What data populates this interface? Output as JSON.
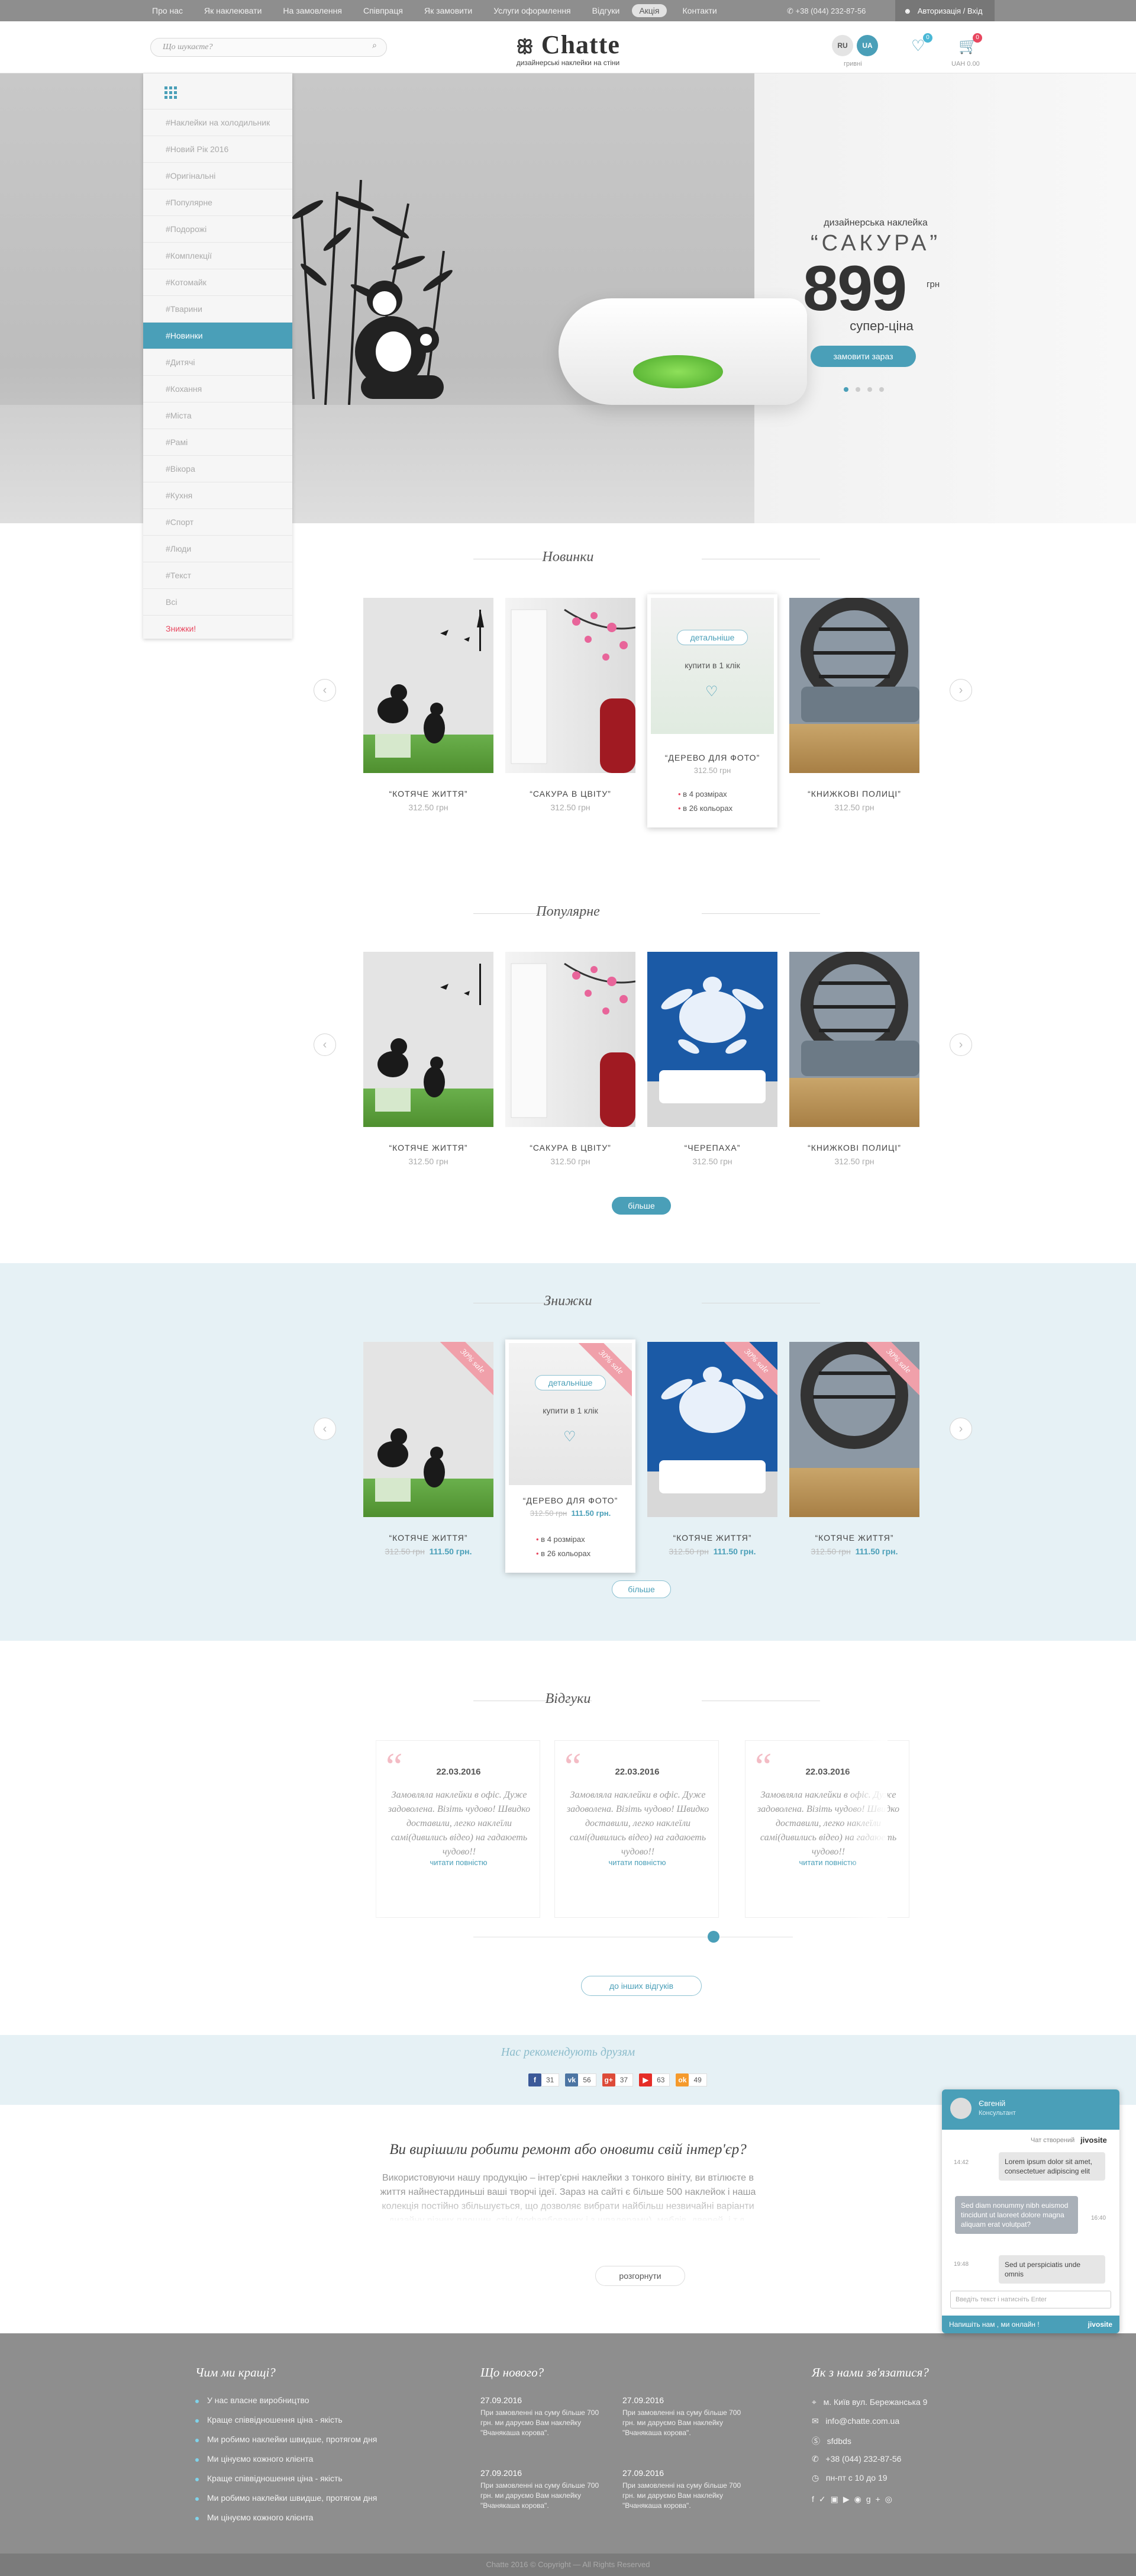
{
  "topnav": {
    "items": [
      "Про нас",
      "Як наклеювати",
      "На замовлення",
      "Співпраця",
      "Як замовити",
      "Услуги оформлення",
      "Відгуки",
      "Акція",
      "Контакти"
    ],
    "phone": "+38 (044) 232-87-56",
    "auth": "Авторизація / Вхід"
  },
  "header": {
    "search_placeholder": "Що шукаєте?",
    "logo_name": "Chatte",
    "logo_tagline": "дизайнерські наклейки на стіни",
    "lang_ru": "RU",
    "lang_ua": "UA",
    "currency": "гривні",
    "fav_count": "0",
    "cart_count": "0",
    "cart_total": "UAH 0.00"
  },
  "sidebar": {
    "items": [
      "#Наклейки на холодильник",
      "#Новий Рік 2016",
      "#Оригінальні",
      "#Популярне",
      "#Подорожі",
      "#Комплекції",
      "#Котомайк",
      "#Тварини",
      "#Новинки",
      "#Дитячі",
      "#Кохання",
      "#Міста",
      "#Рамі",
      "#Вікора",
      "#Кухня",
      "#Спорт",
      "#Люди",
      "#Текст",
      "Всі",
      "Знижки!"
    ],
    "active_index": 8
  },
  "hero": {
    "subtitle": "дизайнерська наклейка",
    "title": "“САКУРА”",
    "price": "899",
    "currency": "грн",
    "tagline": "супер-ціна",
    "button": "замовити зараз",
    "slides": 4,
    "active_slide": 1
  },
  "new": {
    "title": "Новинки",
    "products": [
      {
        "name": "“КОТЯЧЕ ЖИТТЯ”",
        "price": "312.50 грн"
      },
      {
        "name": "“САКУРА В ЦВІТУ”",
        "price": "312.50 грн"
      },
      {
        "name": "“ДЕРЕВО ДЛЯ ФОТО”",
        "price": "312.50 грн"
      },
      {
        "name": "“КНИЖКОВІ ПОЛИЦІ”",
        "price": "312.50 грн"
      }
    ],
    "hover": {
      "details": "детальніше",
      "buy": "купити в 1 клік",
      "opt1": "в 4 розмірах",
      "opt2": "в 26 кольорах"
    }
  },
  "popular": {
    "title": "Популярне",
    "products": [
      {
        "name": "“КОТЯЧЕ ЖИТТЯ”",
        "price": "312.50 грн"
      },
      {
        "name": "“САКУРА В ЦВІТУ”",
        "price": "312.50 грн"
      },
      {
        "name": "“ЧЕРЕПАХА”",
        "price": "312.50 грн"
      },
      {
        "name": "“КНИЖКОВІ ПОЛИЦІ”",
        "price": "312.50 грн"
      }
    ],
    "more": "більше"
  },
  "sale": {
    "title": "Знижки",
    "badge": "30% sale",
    "products": [
      {
        "name": "“КОТЯЧЕ ЖИТТЯ”",
        "old": "312.50 грн",
        "new": "111.50 грн."
      },
      {
        "name": "“ДЕРЕВО ДЛЯ ФОТО”",
        "old": "312.50 грн",
        "new": "111.50 грн."
      },
      {
        "name": "“КОТЯЧЕ ЖИТТЯ”",
        "old": "312.50 грн",
        "new": "111.50 грн."
      },
      {
        "name": "“КОТЯЧЕ ЖИТТЯ”",
        "old": "312.50 грн",
        "new": "111.50 грн."
      }
    ],
    "hover": {
      "details": "детальніше",
      "buy": "купити в 1 клік",
      "opt1": "в 4 розмірах",
      "opt2": "в 26 кольорах"
    },
    "more": "більше"
  },
  "reviews": {
    "title": "Відгуки",
    "items": [
      {
        "date": "22.03.2016",
        "text": "Замовляла наклейки в офіс. Дуже задоволена. Візіть чудово! Швидко доставили, легко наклеїли самі(дивились відео) на гадаюеть чудово!!",
        "more": "читати повністю"
      },
      {
        "date": "22.03.2016",
        "text": "Замовляла наклейки в офіс. Дуже задоволена. Візіть чудово! Швидко доставили, легко наклеїли самі(дивились відео) на гадаюеть чудово!!",
        "more": "читати повністю"
      },
      {
        "date": "22.03.2016",
        "text": "Замовляла наклейки в офіс. Дуже задоволена. Візіть чудово! Швидко доставили, легко наклеїли самі(дивились відео) на гадаюеть чудово!!",
        "more": "читати повністю"
      }
    ],
    "all": "до інших відгуків"
  },
  "recommend": {
    "title": "Нас рекомендують друзям",
    "networks": [
      {
        "icon": "f",
        "count": "31",
        "color": "#3b5998"
      },
      {
        "icon": "vk",
        "count": "56",
        "color": "#4c75a3"
      },
      {
        "icon": "g+",
        "count": "37",
        "color": "#dd4b39"
      },
      {
        "icon": "▶",
        "count": "63",
        "color": "#e52d27"
      },
      {
        "icon": "ok",
        "count": "49",
        "color": "#f59a2c"
      }
    ]
  },
  "seo": {
    "title": "Ви вирішили робити ремонт або оновити свій інтер'єр?",
    "text": "Використовуючи нашу продукцію – інтер'єрні наклейки з тонкого вініту, ви втілюєте в життя найнестардиньші ваші творчі ідеї. Зараз на сайті є більше 500 наклейок і наша колекція постійно збільшується, що дозволяє вибрати найбільш незвичайні варіанти дизайну різних площин, стін (пофарбованих і з шпалерами), меблів, дверей, і т.д.",
    "button": "розгорнути"
  },
  "chat": {
    "name": "Євгеній",
    "role": "Консультант",
    "powered": "Чат створений",
    "brand": "jivosite",
    "msgs": [
      {
        "time": "14:42",
        "text": "Lorem ipsum dolor sit amet, consectetuer adipiscing elit"
      },
      {
        "time": "16:40",
        "text": "Sed diam nonummy nibh euismod tincidunt ut laoreet dolore magna aliquam erat volutpat?"
      },
      {
        "time": "19:48",
        "text": "Sed ut perspiciatis unde omnis"
      }
    ],
    "input": "Введіть текст і натисніть Enter",
    "bottom": "Напишіть нам , ми онлайн !"
  },
  "footer": {
    "col1_title": "Чим ми кращі?",
    "col1_items": [
      "У нас власне виробництво",
      "Краще співвідношення ціна - якість",
      "Ми робимо наклейки швидше, протягом дня",
      "Ми цінуємо кожного клієнта",
      "Краще співвідношення ціна - якість",
      "Ми робимо наклейки швидше, протягом дня",
      "Ми цінуємо кожного клієнта"
    ],
    "col2_title": "Що нового?",
    "news": [
      {
        "date": "27.09.2016",
        "text": "При замовленні на суму більше 700 грн. ми даруємо Вам наклейку \"Вчанякаша корова\"."
      },
      {
        "date": "27.09.2016",
        "text": "При замовленні на суму більше 700 грн. ми даруємо Вам наклейку \"Вчанякаша корова\"."
      },
      {
        "date": "27.09.2016",
        "text": "При замовленні на суму більше 700 грн. ми даруємо Вам наклейку \"Вчанякаша корова\"."
      },
      {
        "date": "27.09.2016",
        "text": "При замовленні на суму більше 700 грн. ми даруємо Вам наклейку \"Вчанякаша корова\"."
      }
    ],
    "col3_title": "Як з нами зв'язатися?",
    "address": "м. Київ вул. Бережанська 9",
    "email": "info@chatte.com.ua",
    "skype": "sfdbds",
    "phone": "+38 (044) 232-87-56",
    "hours": "пн-пт с 10 до 19"
  },
  "copyright": "Chatte 2016 © Copyright — All Rights Reserved"
}
